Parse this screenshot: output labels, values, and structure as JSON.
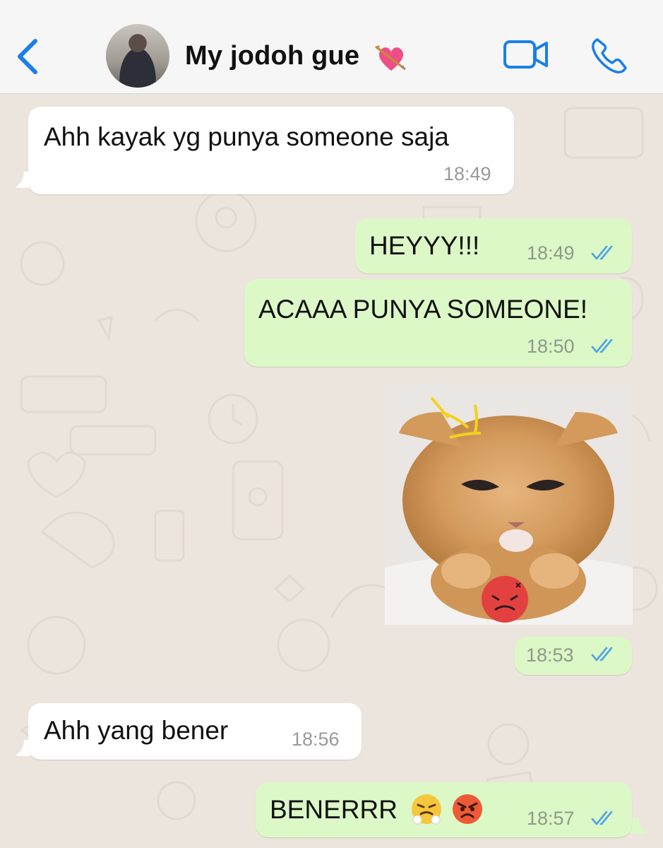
{
  "header": {
    "contact_name": "My jodoh gue",
    "name_emoji_icon": "heart-with-arrow-icon",
    "back_icon": "chevron-left-icon",
    "video_icon": "video-call-icon",
    "phone_icon": "phone-call-icon",
    "accent_color": "#1a7fe9"
  },
  "messages": [
    {
      "direction": "incoming",
      "text": "Ahh kayak yg punya someone saja",
      "time": "18:49"
    },
    {
      "direction": "outgoing",
      "text": "HEYYY!!!",
      "time": "18:49",
      "status": "read"
    },
    {
      "direction": "outgoing",
      "text": "ACAAA PUNYA SOMEONE!",
      "time": "18:50",
      "status": "read"
    },
    {
      "direction": "outgoing",
      "type": "image",
      "image_icon": "angry-kitten-photo",
      "time": "18:53",
      "status": "read"
    },
    {
      "direction": "incoming",
      "text": "Ahh yang bener",
      "time": "18:56"
    },
    {
      "direction": "outgoing",
      "text": "BENERRR",
      "emoji_icons": [
        "steam-from-nose-face-icon",
        "angry-face-icon"
      ],
      "time": "18:57",
      "status": "read"
    }
  ],
  "colors": {
    "incoming_bubble": "#ffffff",
    "outgoing_bubble": "#dcf8c6",
    "read_ticks": "#4fa3e8",
    "chat_background": "#ece5dd"
  }
}
